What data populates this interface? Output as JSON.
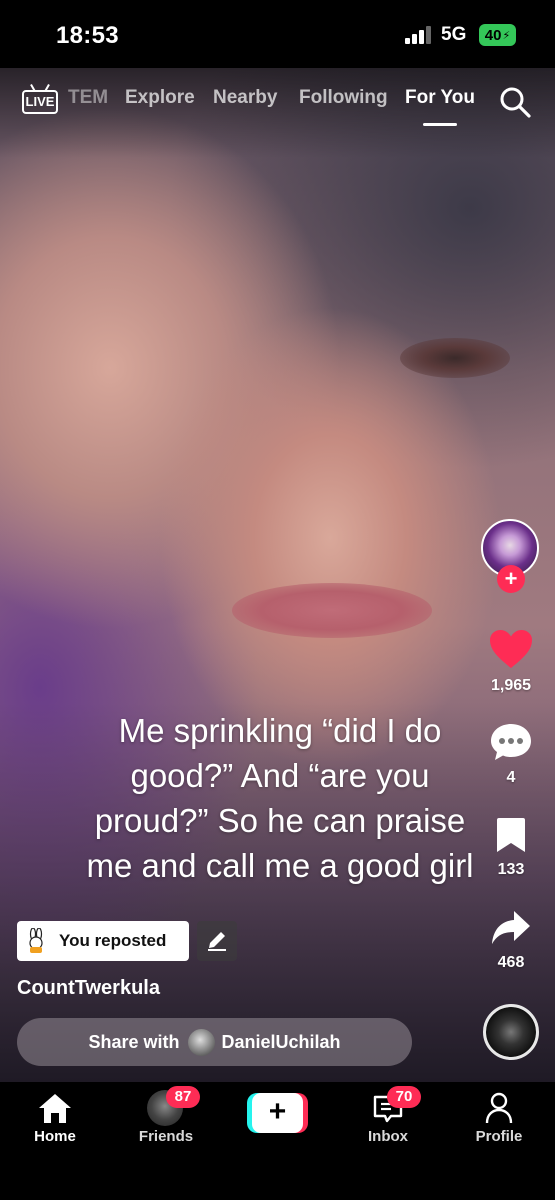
{
  "status_bar": {
    "time": "18:53",
    "network": "5G",
    "battery": "40"
  },
  "top_nav": {
    "live_label": "LIVE",
    "tabs": [
      "TEM",
      "Explore",
      "Nearby",
      "Following",
      "For You"
    ],
    "active_tab": "For You"
  },
  "video": {
    "caption": "Me sprinkling “did I do\ngood?” And “are you\nproud?” So he can praise\nme and call me a good girl"
  },
  "right_rail": {
    "likes": "1,965",
    "comments": "4",
    "saves": "133",
    "shares": "468",
    "like_color": "#fe2c55"
  },
  "post": {
    "repost_label": "You reposted",
    "username": "CountTwerkula"
  },
  "share": {
    "label": "Share with",
    "name": "DanielUchilah"
  },
  "bottom_nav": {
    "home": "Home",
    "friends": "Friends",
    "friends_badge": "87",
    "inbox": "Inbox",
    "inbox_badge": "70",
    "profile": "Profile"
  },
  "icons": [
    "live-icon",
    "search-icon",
    "heart-icon",
    "comment-icon",
    "bookmark-icon",
    "share-icon",
    "edit-icon",
    "home-icon",
    "plus-icon",
    "inbox-icon",
    "profile-icon"
  ],
  "colors": {
    "accent_red": "#fe2c55",
    "accent_cyan": "#25f4ee",
    "battery_green": "#34c759"
  }
}
